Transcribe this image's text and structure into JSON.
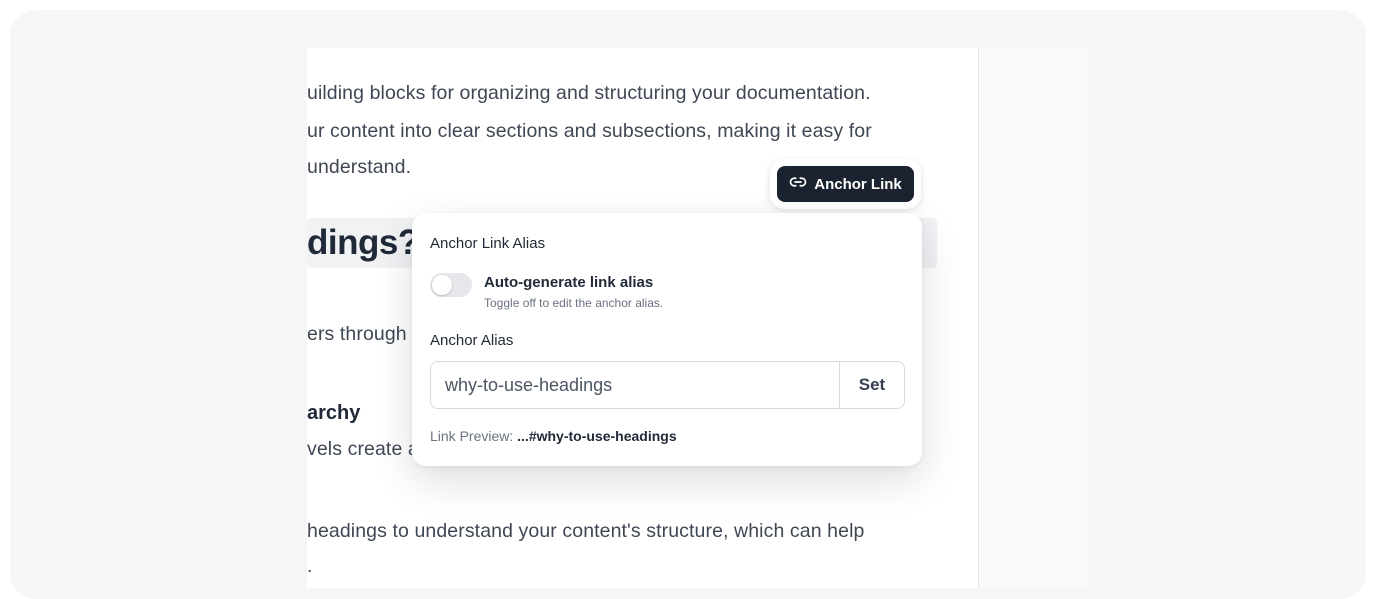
{
  "document": {
    "paragraph_lines": [
      "uilding blocks for organizing and structuring your documentation.",
      "ur content into clear sections and subsections, making it easy for",
      "understand."
    ],
    "heading": "dings?",
    "line_readers": "ers through",
    "subheading": "archy",
    "line_levels": "vels create a",
    "line_headings": "headings to understand your content's structure, which can help",
    "line_end": "."
  },
  "anchor_button": {
    "label": "Anchor Link",
    "icon": "link-icon"
  },
  "popover": {
    "title": "Anchor Link Alias",
    "toggle": {
      "label": "Auto-generate link alias",
      "help": "Toggle off to edit the anchor alias.",
      "state": "off"
    },
    "alias_label": "Anchor Alias",
    "alias_value": "why-to-use-headings",
    "set_label": "Set",
    "preview_label": "Link Preview:",
    "preview_value": "...#why-to-use-headings"
  },
  "colors": {
    "button_dark": "#1c2330",
    "frame_bg": "#f6f6f7"
  }
}
